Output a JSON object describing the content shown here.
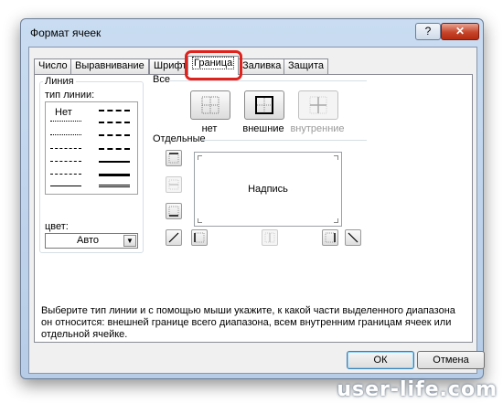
{
  "window": {
    "title": "Формат ячеек",
    "help_symbol": "?",
    "close_symbol": "✕"
  },
  "tabs": [
    "Число",
    "Выравнивание",
    "Шрифт",
    "Граница",
    "Заливка",
    "Защита"
  ],
  "active_tab": "Граница",
  "line_group": {
    "title": "Линия",
    "type_label": "тип линии:",
    "none_label": "Нет",
    "color_label": "цвет:",
    "color_value": "Авто"
  },
  "presets": {
    "title": "Все",
    "none": "нет",
    "outline": "внешние",
    "inside": "внутренние"
  },
  "individual": {
    "title": "Отдельные",
    "preview_text": "Надпись"
  },
  "help_text": "Выберите тип линии и с помощью мыши укажите, к какой части выделенного диапазона он относится: внешней границе всего диапазона, всем внутренним границам ячеек или отдельной ячейке.",
  "buttons": {
    "ok": "ОК",
    "cancel": "Отмена"
  },
  "watermark": "user-life.com",
  "colors": {
    "highlight": "#e0211c",
    "title_close": "#c6452b"
  }
}
